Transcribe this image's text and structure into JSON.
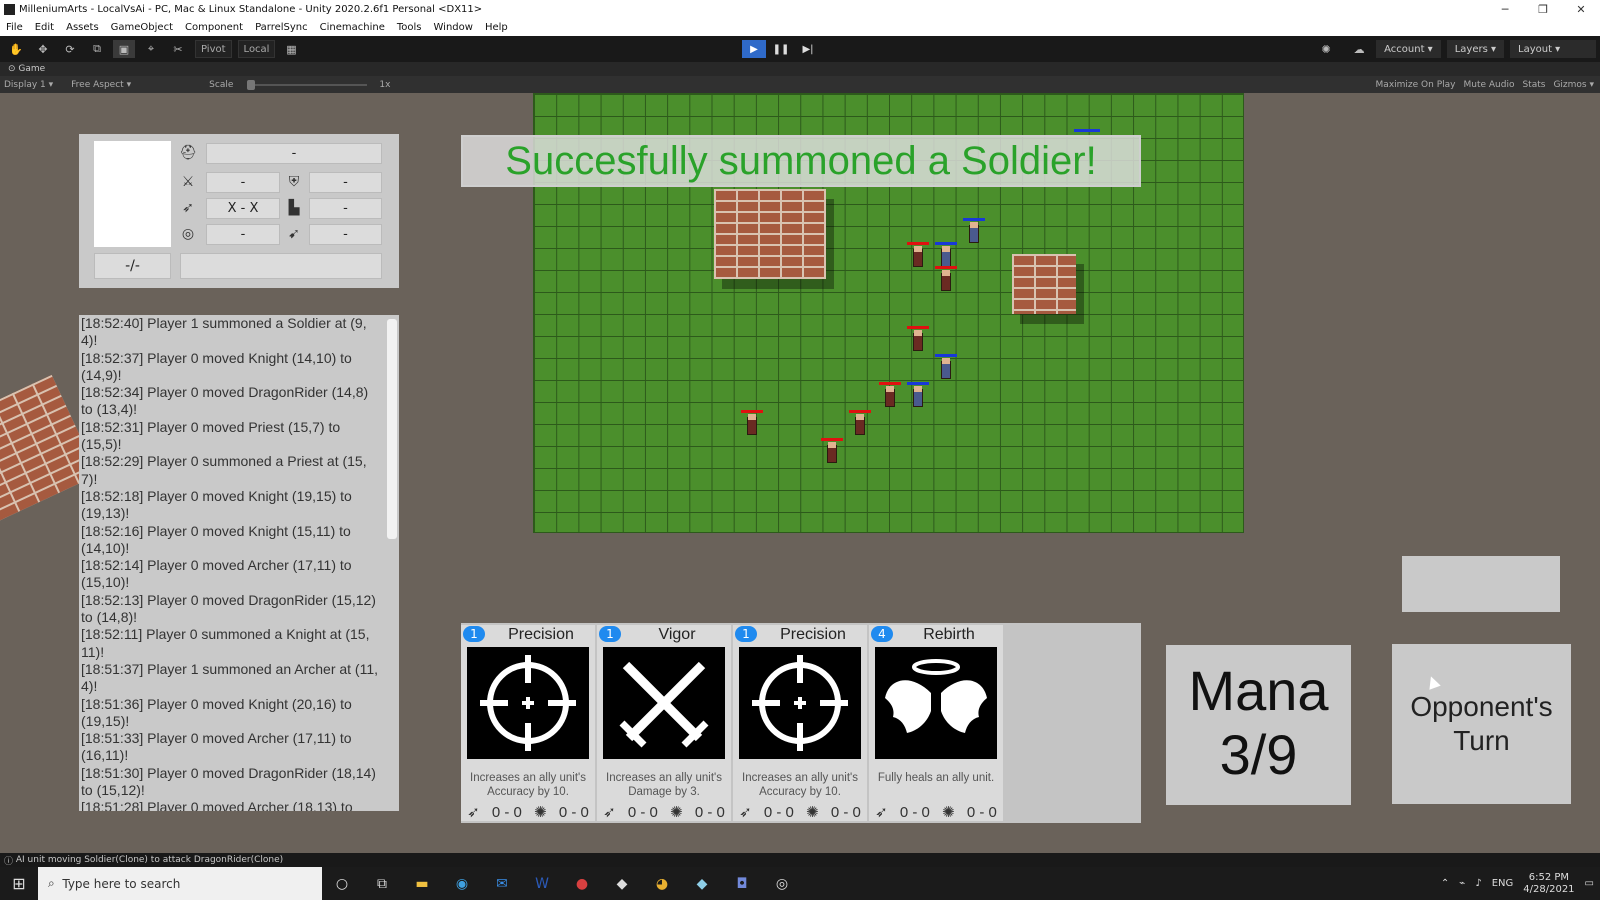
{
  "window": {
    "title": "MilleniumArts - LocalVsAi - PC, Mac & Linux Standalone - Unity 2020.2.6f1 Personal <DX11>",
    "minimize": "─",
    "maximize": "❐",
    "close": "✕"
  },
  "menu": [
    "File",
    "Edit",
    "Assets",
    "GameObject",
    "Component",
    "ParrelSync",
    "Cinemachine",
    "Tools",
    "Window",
    "Help"
  ],
  "toolbar": {
    "pivot": "Pivot",
    "local": "Local",
    "account": "Account",
    "layers": "Layers",
    "layout": "Layout"
  },
  "game_tab": {
    "label": "Game",
    "display": "Display 1",
    "aspect": "Free Aspect",
    "scale_label": "Scale",
    "scale_value": "1x",
    "maximize": "Maximize On Play",
    "mute": "Mute Audio",
    "stats": "Stats",
    "gizmos": "Gizmos"
  },
  "banner": "Succesfully summoned a Soldier!",
  "unit_info": {
    "name": "-",
    "attack": "-",
    "defense": "-",
    "range": "X - X",
    "move": "-",
    "accuracy": "-",
    "agility": "-",
    "health": "-/-",
    "status": ""
  },
  "log": [
    "[18:52:40] Player 1 summoned a Soldier at (9, 4)!",
    "[18:52:37] Player 0 moved Knight (14,10) to (14,9)!",
    "[18:52:34] Player 0 moved DragonRider (14,8) to (13,4)!",
    "[18:52:31] Player 0 moved Priest (15,7) to (15,5)!",
    "[18:52:29] Player 0 summoned a Priest at (15, 7)!",
    "[18:52:18] Player 0 moved Knight (19,15) to (19,13)!",
    "[18:52:16] Player 0 moved Knight (15,11) to (14,10)!",
    "[18:52:14] Player 0 moved Archer (17,11) to (15,10)!",
    "[18:52:13] Player 0 moved DragonRider (15,12) to (14,8)!",
    "[18:52:11] Player 0 summoned a Knight at (15, 11)!",
    "[18:51:37] Player 1 summoned an Archer at (11, 4)!",
    "[18:51:36] Player 0 moved Knight (20,16) to (19,15)!",
    "[18:51:33] Player 0 moved Archer (17,11) to (16,11)!",
    "[18:51:30] Player 0 moved DragonRider (18,14) to (15,12)!",
    "[18:51:28] Player 0 moved Archer (18,13) to"
  ],
  "cards": [
    {
      "cost": "1",
      "name": "Precision",
      "art": "crosshair-icon",
      "desc": "Increases an ally unit's Accuracy by 10.",
      "stat_a": "0 - 0",
      "stat_b": "0 - 0"
    },
    {
      "cost": "1",
      "name": "Vigor",
      "art": "crossed-swords-icon",
      "desc": "Increases an ally unit's Damage by 3.",
      "stat_a": "0 - 0",
      "stat_b": "0 - 0"
    },
    {
      "cost": "1",
      "name": "Precision",
      "art": "crosshair-icon",
      "desc": "Increases an ally unit's Accuracy by 10.",
      "stat_a": "0 - 0",
      "stat_b": "0 - 0"
    },
    {
      "cost": "4",
      "name": "Rebirth",
      "art": "wings-icon",
      "desc": "Fully heals an ally unit.",
      "stat_a": "0 - 0",
      "stat_b": "0 - 0"
    }
  ],
  "mana": {
    "label": "Mana",
    "value": "3/9"
  },
  "turn": "Opponent's Turn",
  "status_message": "AI unit moving Soldier(Clone) to attack DragonRider(Clone)",
  "taskbar": {
    "search_placeholder": "Type here to search",
    "language": "ENG",
    "time": "6:52 PM",
    "date": "4/28/2021"
  },
  "colors": {
    "banner_text": "#2aa22a",
    "board_green": "#4b8f2c",
    "team_red": "#e01010",
    "team_blue": "#1838d8",
    "card_cost": "#1f8aef"
  }
}
